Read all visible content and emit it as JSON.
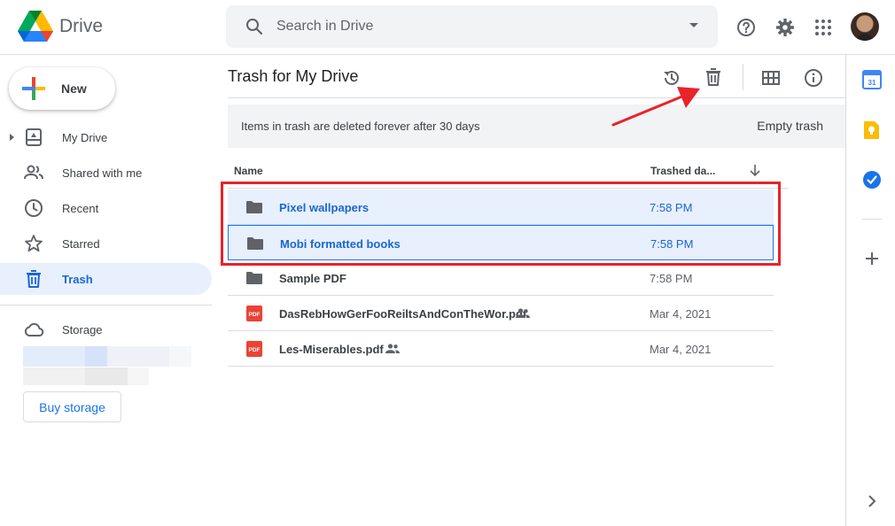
{
  "app": {
    "name": "Drive"
  },
  "search": {
    "placeholder": "Search in Drive"
  },
  "header_icons": [
    "help-icon",
    "settings-gear-icon",
    "apps-grid-icon",
    "account-avatar"
  ],
  "sidebar": {
    "new_label": "New",
    "items": [
      {
        "label": "My Drive",
        "icon": "my-drive-icon",
        "active": false
      },
      {
        "label": "Shared with me",
        "icon": "people-icon",
        "active": false
      },
      {
        "label": "Recent",
        "icon": "clock-icon",
        "active": false
      },
      {
        "label": "Starred",
        "icon": "star-icon",
        "active": false
      },
      {
        "label": "Trash",
        "icon": "trash-icon",
        "active": true
      }
    ],
    "storage_label": "Storage",
    "buy_storage_label": "Buy storage"
  },
  "main": {
    "title": "Trash for My Drive",
    "toolbar_icons": [
      "restore-icon",
      "delete-forever-icon",
      "grid-view-icon",
      "info-icon"
    ],
    "banner": {
      "message": "Items in trash are deleted forever after 30 days",
      "action": "Empty trash"
    },
    "columns": {
      "name": "Name",
      "trashed": "Trashed da..."
    },
    "rows": [
      {
        "name": "Pixel wallpapers",
        "type": "folder",
        "date": "7:58 PM",
        "selected": true,
        "shared": false
      },
      {
        "name": "Mobi formatted books",
        "type": "folder",
        "date": "7:58 PM",
        "selected": true,
        "shared": false
      },
      {
        "name": "Sample PDF",
        "type": "folder",
        "date": "7:58 PM",
        "selected": false,
        "shared": false
      },
      {
        "name": "DasRebHowGerFooReiltsAndConTheWor.pdf",
        "type": "pdf",
        "date": "Mar 4, 2021",
        "selected": false,
        "shared": true
      },
      {
        "name": "Les-Miserables.pdf",
        "type": "pdf",
        "date": "Mar 4, 2021",
        "selected": false,
        "shared": true
      }
    ],
    "pdf_badge": "PDF"
  },
  "colors": {
    "accent": "#1a73e8",
    "selected_bg": "#e8f0fe",
    "annotation_red": "#e8232a"
  }
}
